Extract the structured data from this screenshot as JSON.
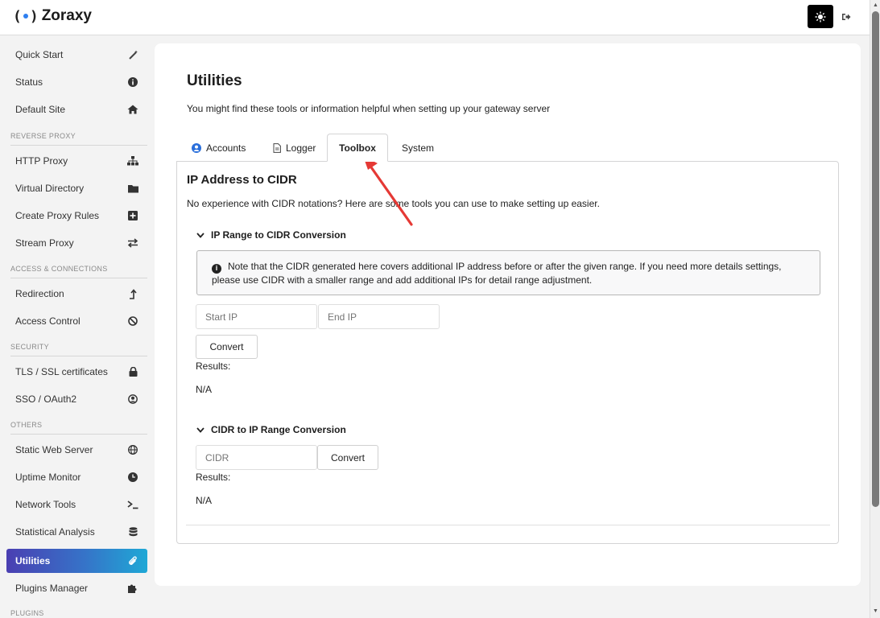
{
  "app": {
    "name": "Zoraxy"
  },
  "icons": {
    "theme": "gear-sun-icon",
    "logout": "logout-icon"
  },
  "sidebar": {
    "items": [
      {
        "label": "Quick Start",
        "icon": "magic-wand-icon"
      },
      {
        "label": "Status",
        "icon": "info-circle-icon"
      },
      {
        "label": "Default Site",
        "icon": "home-icon"
      },
      {
        "section": "REVERSE PROXY"
      },
      {
        "label": "HTTP Proxy",
        "icon": "sitemap-icon"
      },
      {
        "label": "Virtual Directory",
        "icon": "folder-icon"
      },
      {
        "label": "Create Proxy Rules",
        "icon": "plus-square-icon"
      },
      {
        "label": "Stream Proxy",
        "icon": "exchange-icon"
      },
      {
        "section": "ACCESS & CONNECTIONS"
      },
      {
        "label": "Redirection",
        "icon": "level-up-icon"
      },
      {
        "label": "Access Control",
        "icon": "ban-icon"
      },
      {
        "section": "SECURITY"
      },
      {
        "label": "TLS / SSL certificates",
        "icon": "lock-icon"
      },
      {
        "label": "SSO / OAuth2",
        "icon": "user-circle-icon"
      },
      {
        "section": "OTHERS"
      },
      {
        "label": "Static Web Server",
        "icon": "globe-icon"
      },
      {
        "label": "Uptime Monitor",
        "icon": "clock-icon"
      },
      {
        "label": "Network Tools",
        "icon": "terminal-icon"
      },
      {
        "label": "Statistical Analysis",
        "icon": "database-icon"
      },
      {
        "label": "Utilities",
        "icon": "paperclip-icon",
        "active": true
      },
      {
        "label": "Plugins Manager",
        "icon": "puzzle-icon"
      },
      {
        "section": "PLUGINS"
      }
    ]
  },
  "page": {
    "title": "Utilities",
    "description": "You might find these tools or information helpful when setting up your gateway server"
  },
  "tabs": [
    {
      "label": "Accounts",
      "icon": "user-circle-icon"
    },
    {
      "label": "Logger",
      "icon": "file-icon"
    },
    {
      "label": "Toolbox",
      "active": true
    },
    {
      "label": "System"
    }
  ],
  "toolbox": {
    "title": "IP Address to CIDR",
    "description": "No experience with CIDR notations? Here are some tools you can use to make setting up easier.",
    "range_to_cidr": {
      "heading": "IP Range to CIDR Conversion",
      "note": "Note that the CIDR generated here covers additional IP address before or after the given range. If you need more details settings, please use CIDR with a smaller range and add additional IPs for detail range adjustment.",
      "start_placeholder": "Start IP",
      "end_placeholder": "End IP",
      "convert_label": "Convert",
      "results_label": "Results:",
      "result_value": "N/A"
    },
    "cidr_to_range": {
      "heading": "CIDR to IP Range Conversion",
      "cidr_placeholder": "CIDR",
      "convert_label": "Convert",
      "results_label": "Results:",
      "result_value": "N/A"
    }
  },
  "colors": {
    "active_gradient_start": "#4a3fb2",
    "active_gradient_end": "#1fa8d6",
    "annotation_arrow": "#e53935"
  }
}
